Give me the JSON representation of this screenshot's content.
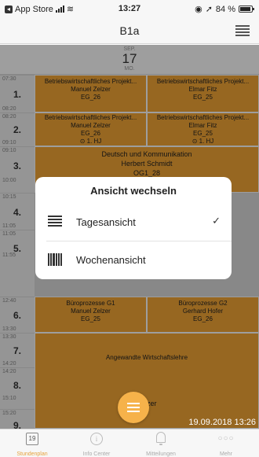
{
  "status_bar": {
    "back_app": "App Store",
    "time": "13:27",
    "battery": "84 %"
  },
  "nav": {
    "title": "B1a"
  },
  "date_header": {
    "month": "SEP.",
    "day": "17",
    "weekday": "MO."
  },
  "periods": [
    {
      "num": "1.",
      "start": "07:30",
      "end": "08:20"
    },
    {
      "num": "2.",
      "start": "08:20",
      "end": "09:10"
    },
    {
      "num": "3.",
      "start": "09:10",
      "end": "10:00"
    },
    {
      "num": "4.",
      "start": "10:15",
      "end": "11:05"
    },
    {
      "num": "5.",
      "start": "11:05",
      "end": "11:55"
    },
    {
      "num": "6.",
      "start": "12:40",
      "end": "13:30"
    },
    {
      "num": "7.",
      "start": "13:30",
      "end": "14:20"
    },
    {
      "num": "8.",
      "start": "14:20",
      "end": "15:10"
    },
    {
      "num": "9.",
      "start": "15:20",
      "end": ""
    }
  ],
  "lessons": {
    "p1_left": {
      "subject": "Betriebswirtschaftliches Projekt...",
      "teacher": "Manuel Zelzer",
      "room": "EG_26"
    },
    "p1_right": {
      "subject": "Betriebswirtschaftliches Projekt...",
      "teacher": "Elmar Fitz",
      "room": "EG_25"
    },
    "p2_left": {
      "subject": "Betriebswirtschaftliches Projekt...",
      "teacher": "Manuel Zelzer",
      "room": "EG_26",
      "note": "⊙ 1. HJ"
    },
    "p2_right": {
      "subject": "Betriebswirtschaftliches Projekt...",
      "teacher": "Elmar Fitz",
      "room": "EG_25",
      "note": "⊙ 1. HJ"
    },
    "p3": {
      "subject": "Deutsch und Kommunikation",
      "teacher": "Herbert Schmidt",
      "room": "OG1_28"
    },
    "p6_left": {
      "subject": "Büroprozesse G1",
      "teacher": "Manuel Zelzer",
      "room": "EG_25"
    },
    "p6_right": {
      "subject": "Büroprozesse G2",
      "teacher": "Gerhard Hofer",
      "room": "EG_26"
    },
    "p7": {
      "subject": "Angewandte Wirtschaftslehre",
      "teacher_partial": "Zelzer"
    }
  },
  "dialog": {
    "title": "Ansicht wechseln",
    "options": [
      {
        "label": "Tagesansicht",
        "icon": "list-icon",
        "selected": true
      },
      {
        "label": "Wochenansicht",
        "icon": "week-grid-icon",
        "selected": false
      }
    ],
    "check": "✓"
  },
  "timestamp": "19.09.2018 13:26",
  "tabs": [
    {
      "label": "Stundenplan",
      "icon": "calendar-icon",
      "badge": "19",
      "active": true
    },
    {
      "label": "Info Center",
      "icon": "info-icon",
      "glyph": "i",
      "active": false
    },
    {
      "label": "Mitteilungen",
      "icon": "bell-icon",
      "active": false
    },
    {
      "label": "Mehr",
      "icon": "more-icon",
      "glyph": "○○○",
      "active": false
    }
  ],
  "colors": {
    "lesson": "#f4a636",
    "accent": "#e6a23c"
  }
}
